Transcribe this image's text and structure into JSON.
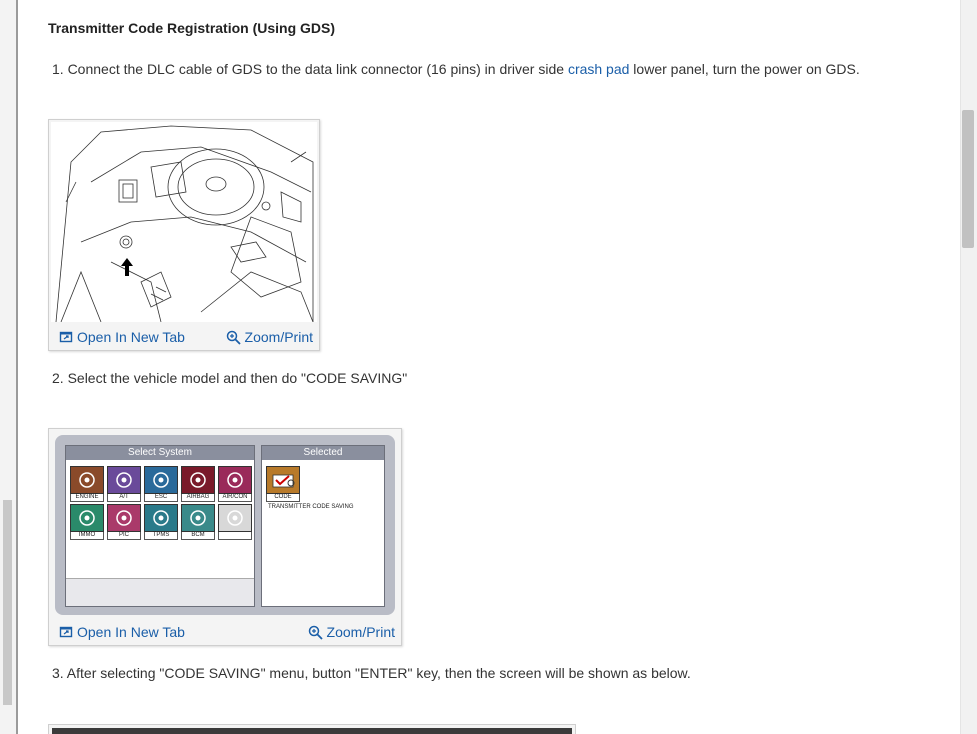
{
  "section_title": "Transmitter Code Registration (Using GDS)",
  "steps": {
    "s1_pre": "1. Connect the DLC cable of GDS to the data link connector (16 pins) in driver side ",
    "s1_link": "crash pad",
    "s1_post": " lower panel, turn the power on GDS.",
    "s2": "2. Select the vehicle model and then do \"CODE SAVING\"",
    "s3": "3. After selecting \"CODE SAVING\" menu, button \"ENTER\" key, then the screen will be shown as below."
  },
  "figure_actions": {
    "open_new_tab": "Open In New Tab",
    "zoom_print": "Zoom/Print"
  },
  "gds": {
    "select_system_header": "Select System",
    "selected_header": "Selected",
    "systems": [
      {
        "label": "ENGINE",
        "color": "#8a4a2a"
      },
      {
        "label": "A/T",
        "color": "#6a4a9a"
      },
      {
        "label": "ESC",
        "color": "#2a6a9a"
      },
      {
        "label": "AIRBAG",
        "color": "#7a1a2a"
      },
      {
        "label": "AIR/CON",
        "color": "#9a2a5a"
      },
      {
        "label": "IMMO",
        "color": "#2a8a6a"
      },
      {
        "label": "PIC",
        "color": "#aa3a6a"
      },
      {
        "label": "TPMS",
        "color": "#2a7a8a"
      },
      {
        "label": "BCM",
        "color": "#3a8a8a"
      },
      {
        "label": "",
        "color": "#d8d8d8"
      }
    ],
    "selected_code_label": "CODE",
    "selected_note": "TRANSMITTER CODE SAVING"
  },
  "colors": {
    "link": "#1a5ea8"
  }
}
